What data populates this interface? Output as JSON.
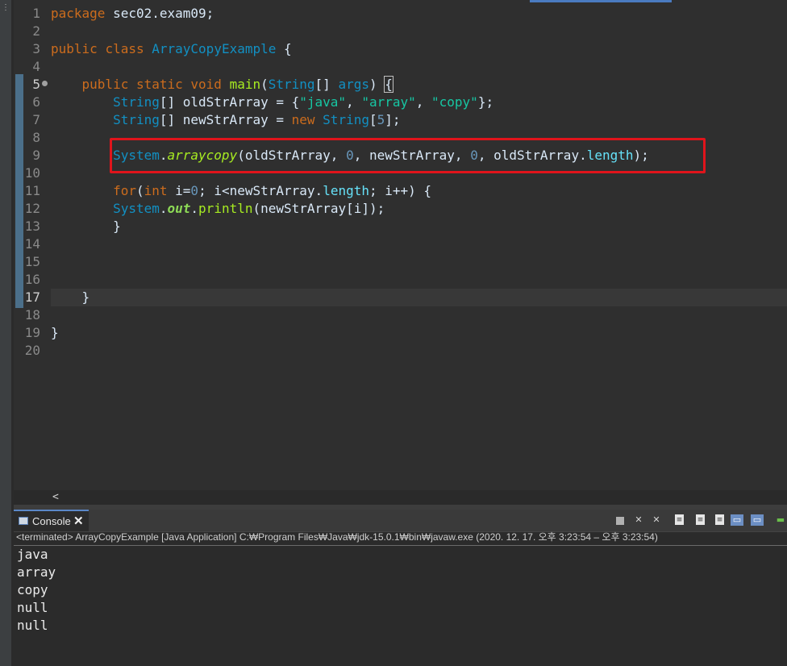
{
  "editor": {
    "line_numbers": [
      "1",
      "2",
      "3",
      "4",
      "5",
      "6",
      "7",
      "8",
      "9",
      "10",
      "11",
      "12",
      "13",
      "14",
      "15",
      "16",
      "17",
      "18",
      "19",
      "20"
    ]
  },
  "code": {
    "l1_kw": "package",
    "l1_rest": " sec02.exam09;",
    "l3_kw1": "public",
    "l3_kw2": "class",
    "l3_name": "ArrayCopyExample",
    "l3_brace": " {",
    "l5_kw1": "public",
    "l5_kw2": "static",
    "l5_kw3": "void",
    "l5_name": "main",
    "l5_open": "(",
    "l5_type": "String",
    "l5_arr": "[] ",
    "l5_param": "args",
    "l5_close": ") ",
    "l5_brace": "{",
    "l6_type": "String",
    "l6_a": "[] oldStrArray = {",
    "l6_s1": "\"java\"",
    "l6_c1": ", ",
    "l6_s2": "\"array\"",
    "l6_c2": ", ",
    "l6_s3": "\"copy\"",
    "l6_end": "};",
    "l7_type": "String",
    "l7_a": "[] newStrArray = ",
    "l7_kw": "new",
    "l7_type2": "String",
    "l7_b": "[",
    "l7_num": "5",
    "l7_end": "];",
    "l9_type": "System",
    "l9_dot": ".",
    "l9_method": "arraycopy",
    "l9_a": "(oldStrArray, ",
    "l9_n1": "0",
    "l9_b": ", newStrArray, ",
    "l9_n2": "0",
    "l9_c": ", oldStrArray.",
    "l9_field": "length",
    "l9_end": ");",
    "l11_kw": "for",
    "l11_a": "(",
    "l11_kw2": "int",
    "l11_b": " i=",
    "l11_num": "0",
    "l11_c": "; i<newStrArray.",
    "l11_field": "length",
    "l11_d": "; i++) {",
    "l12_type": "System",
    "l12_dot": ".",
    "l12_field": "out",
    "l12_dot2": ".",
    "l12_method": "println",
    "l12_rest": "(newStrArray[i]);",
    "l13": "}",
    "l17": "}",
    "l19": "}"
  },
  "console": {
    "tab_label": "Console",
    "close_glyph": "✕",
    "status": "<terminated> ArrayCopyExample [Java Application] C:₩Program Files₩Java₩jdk-15.0.1₩bin₩javaw.exe  (2020. 12. 17. 오후 3:23:54 – 오후 3:23:54)",
    "output": [
      "java",
      "array",
      "copy",
      "null",
      "null"
    ]
  },
  "scroll": {
    "left_arrow": "<"
  },
  "colors": {
    "highlight_box": "#e0141b",
    "keyword": "#cc6c1d",
    "type": "#1290c3",
    "string": "#17c6a3"
  }
}
